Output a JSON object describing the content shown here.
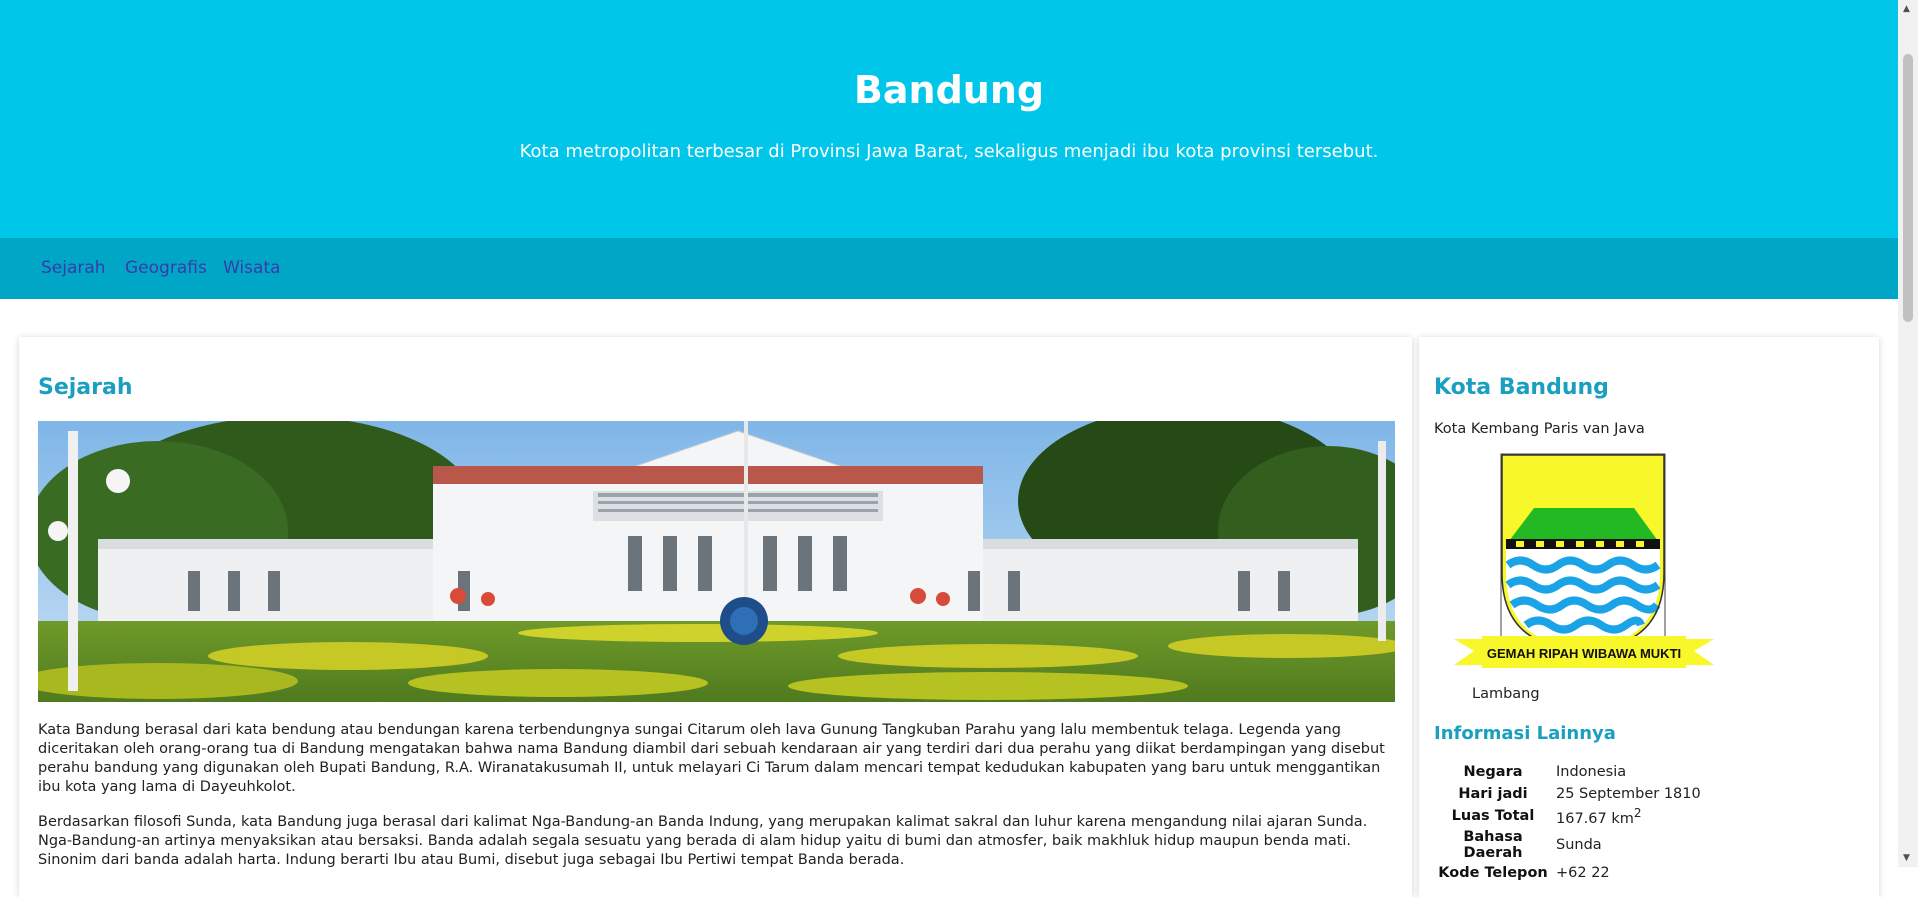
{
  "header": {
    "title": "Bandung",
    "subtitle": "Kota metropolitan terbesar di Provinsi Jawa Barat, sekaligus menjadi ibu kota provinsi tersebut."
  },
  "nav": {
    "items": [
      "Sejarah",
      "Geografis",
      "Wisata"
    ]
  },
  "main": {
    "heading": "Sejarah",
    "paragraphs": [
      "Kata Bandung berasal dari kata bendung atau bendungan karena terbendungnya sungai Citarum oleh lava Gunung Tangkuban Parahu yang lalu membentuk telaga. Legenda yang diceritakan oleh orang-orang tua di Bandung mengatakan bahwa nama Bandung diambil dari sebuah kendaraan air yang terdiri dari dua perahu yang diikat berdampingan yang disebut perahu bandung yang digunakan oleh Bupati Bandung, R.A. Wiranatakusumah II, untuk melayari Ci Tarum dalam mencari tempat kedudukan kabupaten yang baru untuk menggantikan ibu kota yang lama di Dayeuhkolot.",
      "Berdasarkan filosofi Sunda, kata Bandung juga berasal dari kalimat Nga-Bandung-an Banda Indung, yang merupakan kalimat sakral dan luhur karena mengandung nilai ajaran Sunda. Nga-Bandung-an artinya menyaksikan atau bersaksi. Banda adalah segala sesuatu yang berada di alam hidup yaitu di bumi dan atmosfer, baik makhluk hidup maupun benda mati. Sinonim dari banda adalah harta. Indung berarti Ibu atau Bumi, disebut juga sebagai Ibu Pertiwi tempat Banda berada."
    ]
  },
  "side": {
    "heading": "Kota Bandung",
    "motto": "Kota Kembang Paris van Java",
    "emblem_banner_text": "GEMAH RIPAH WIBAWA MUKTI",
    "emblem_caption": "Lambang",
    "info_heading": "Informasi Lainnya",
    "info_rows": [
      {
        "key": "Negara",
        "value": "Indonesia"
      },
      {
        "key": "Hari jadi",
        "value": "25 September 1810"
      },
      {
        "key": "Luas Total",
        "value": "167.67 km",
        "sup": "2"
      },
      {
        "key": "Bahasa Daerah",
        "value": "Sunda"
      },
      {
        "key": "Kode Telepon",
        "value": "+62 22"
      }
    ]
  },
  "colors": {
    "header_bg": "#00c6ea",
    "nav_bg": "#00a6c6",
    "nav_link": "#3a3aa8",
    "heading": "#1a9fc0"
  }
}
